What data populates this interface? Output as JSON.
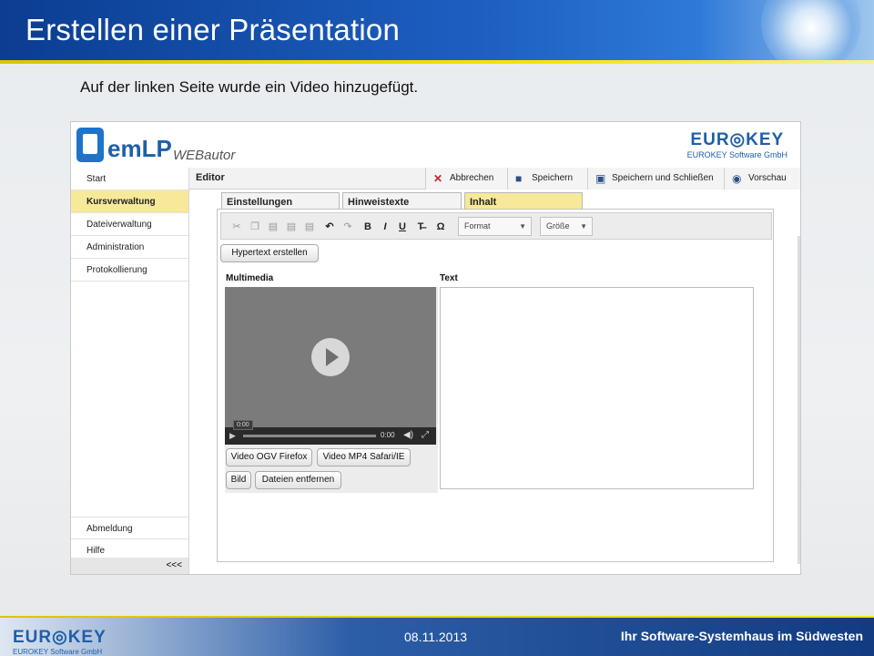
{
  "slide": {
    "title": "Erstellen einer Präsentation",
    "subtitle": "Auf der linken Seite wurde ein Video hinzugefügt."
  },
  "app": {
    "logo_text": "emLP",
    "logo_sub": "WEBautor",
    "brand_name": "EUR◎KEY",
    "brand_sub": "EUROKEY Software GmbH",
    "sidebar": {
      "items": [
        {
          "label": "Start",
          "active": false
        },
        {
          "label": "Kursverwaltung",
          "active": true
        },
        {
          "label": "Dateiverwaltung",
          "active": false
        },
        {
          "label": "Administration",
          "active": false
        },
        {
          "label": "Protokollierung",
          "active": false
        }
      ],
      "bottom_items": [
        {
          "label": "Abmeldung"
        },
        {
          "label": "Hilfe"
        }
      ],
      "collapse_label": "<<<"
    },
    "toolbar": {
      "editor_label": "Editor",
      "cancel_label": "Abbrechen",
      "save_label": "Speichern",
      "save_close_label": "Speichern und Schließen",
      "preview_label": "Vorschau"
    },
    "tabs": [
      {
        "label": "Einstellungen",
        "active": false
      },
      {
        "label": "Hinweistexte",
        "active": false
      },
      {
        "label": "Inhalt",
        "active": true
      }
    ],
    "rte": {
      "format_label": "Format",
      "size_label": "Größe",
      "icons": [
        "cut-icon",
        "copy-icon",
        "paste-icon",
        "paste-text-icon",
        "paste-word-icon",
        "undo-icon",
        "redo-icon",
        "bold-icon",
        "italic-icon",
        "underline-icon",
        "remove-format-icon",
        "special-char-icon"
      ]
    },
    "content": {
      "hypertext_button": "Hypertext erstellen",
      "multimedia_label": "Multimedia",
      "text_label": "Text",
      "video": {
        "time_tooltip": "0:00",
        "time": "0:00"
      },
      "media_buttons": {
        "ogv": "Video OGV Firefox",
        "mp4": "Video MP4 Safari/IE",
        "image": "Bild",
        "remove": "Dateien entfernen"
      }
    }
  },
  "footer": {
    "brand_name": "EUR◎KEY",
    "brand_sub": "EUROKEY Software GmbH",
    "date": "08.11.2013",
    "tagline": "Ihr Software-Systemhaus im Südwesten"
  },
  "colors": {
    "header_blue": "#0b3d91",
    "accent_yellow": "#f3e400",
    "active_highlight": "#f6e99a",
    "brand_blue": "#1f5fa8"
  }
}
